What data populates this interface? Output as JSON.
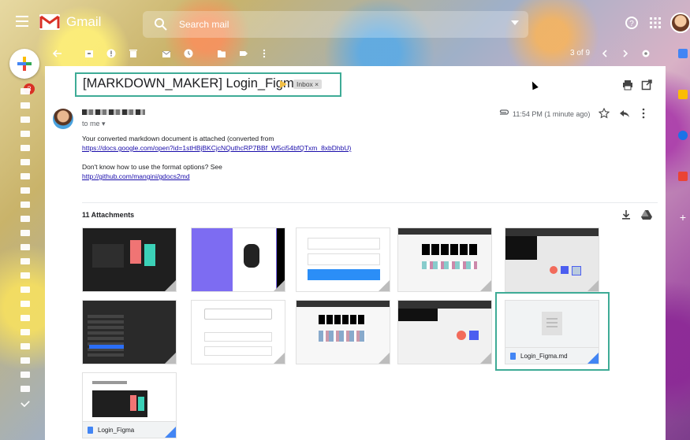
{
  "app": {
    "name": "Gmail"
  },
  "search": {
    "placeholder": "Search mail"
  },
  "left_rail": {
    "inbox_badge": "3"
  },
  "toolbar": {
    "pager": "3 of 9"
  },
  "email": {
    "subject": "[MARKDOWN_MAKER] Login_Figma",
    "label_chip": "Inbox ×",
    "to_line": "to me ▾",
    "timestamp": "11:54 PM (1 minute ago)",
    "body_line1": "Your converted markdown document is attached (converted from",
    "body_link1": "https://docs.google.com/open?id=1stHBjBKCjcNQuthcRP7BBf_W5ci54bfQTxm_8xbDhbU)",
    "body_line2": "Don't know how to use the format options? See",
    "body_link2": "http://github.com/mangini/gdocs2md",
    "attachments_title": "11 Attachments",
    "attachments": [
      {
        "label": "Login_Figma.md"
      },
      {
        "label": "Login_Figma"
      }
    ]
  },
  "colors": {
    "highlight_box": "#3eab96",
    "gmail_red": "#d93025",
    "link": "#1a0dab",
    "label_chevron": "#f2c046",
    "doc_blue": "#4285f4"
  },
  "icons": [
    "menu-icon",
    "gmail-logo-icon",
    "search-icon",
    "help-icon",
    "apps-icon",
    "compose-plus-icon",
    "back-arrow-icon",
    "archive-icon",
    "report-spam-icon",
    "delete-icon",
    "mark-unread-icon",
    "snooze-icon",
    "move-to-icon",
    "labels-icon",
    "more-vert-icon",
    "prev-icon",
    "next-icon",
    "settings-icon",
    "print-icon",
    "open-new-window-icon",
    "attachment-clip-icon",
    "star-icon",
    "reply-icon",
    "download-all-icon",
    "drive-icon",
    "doc-icon"
  ]
}
